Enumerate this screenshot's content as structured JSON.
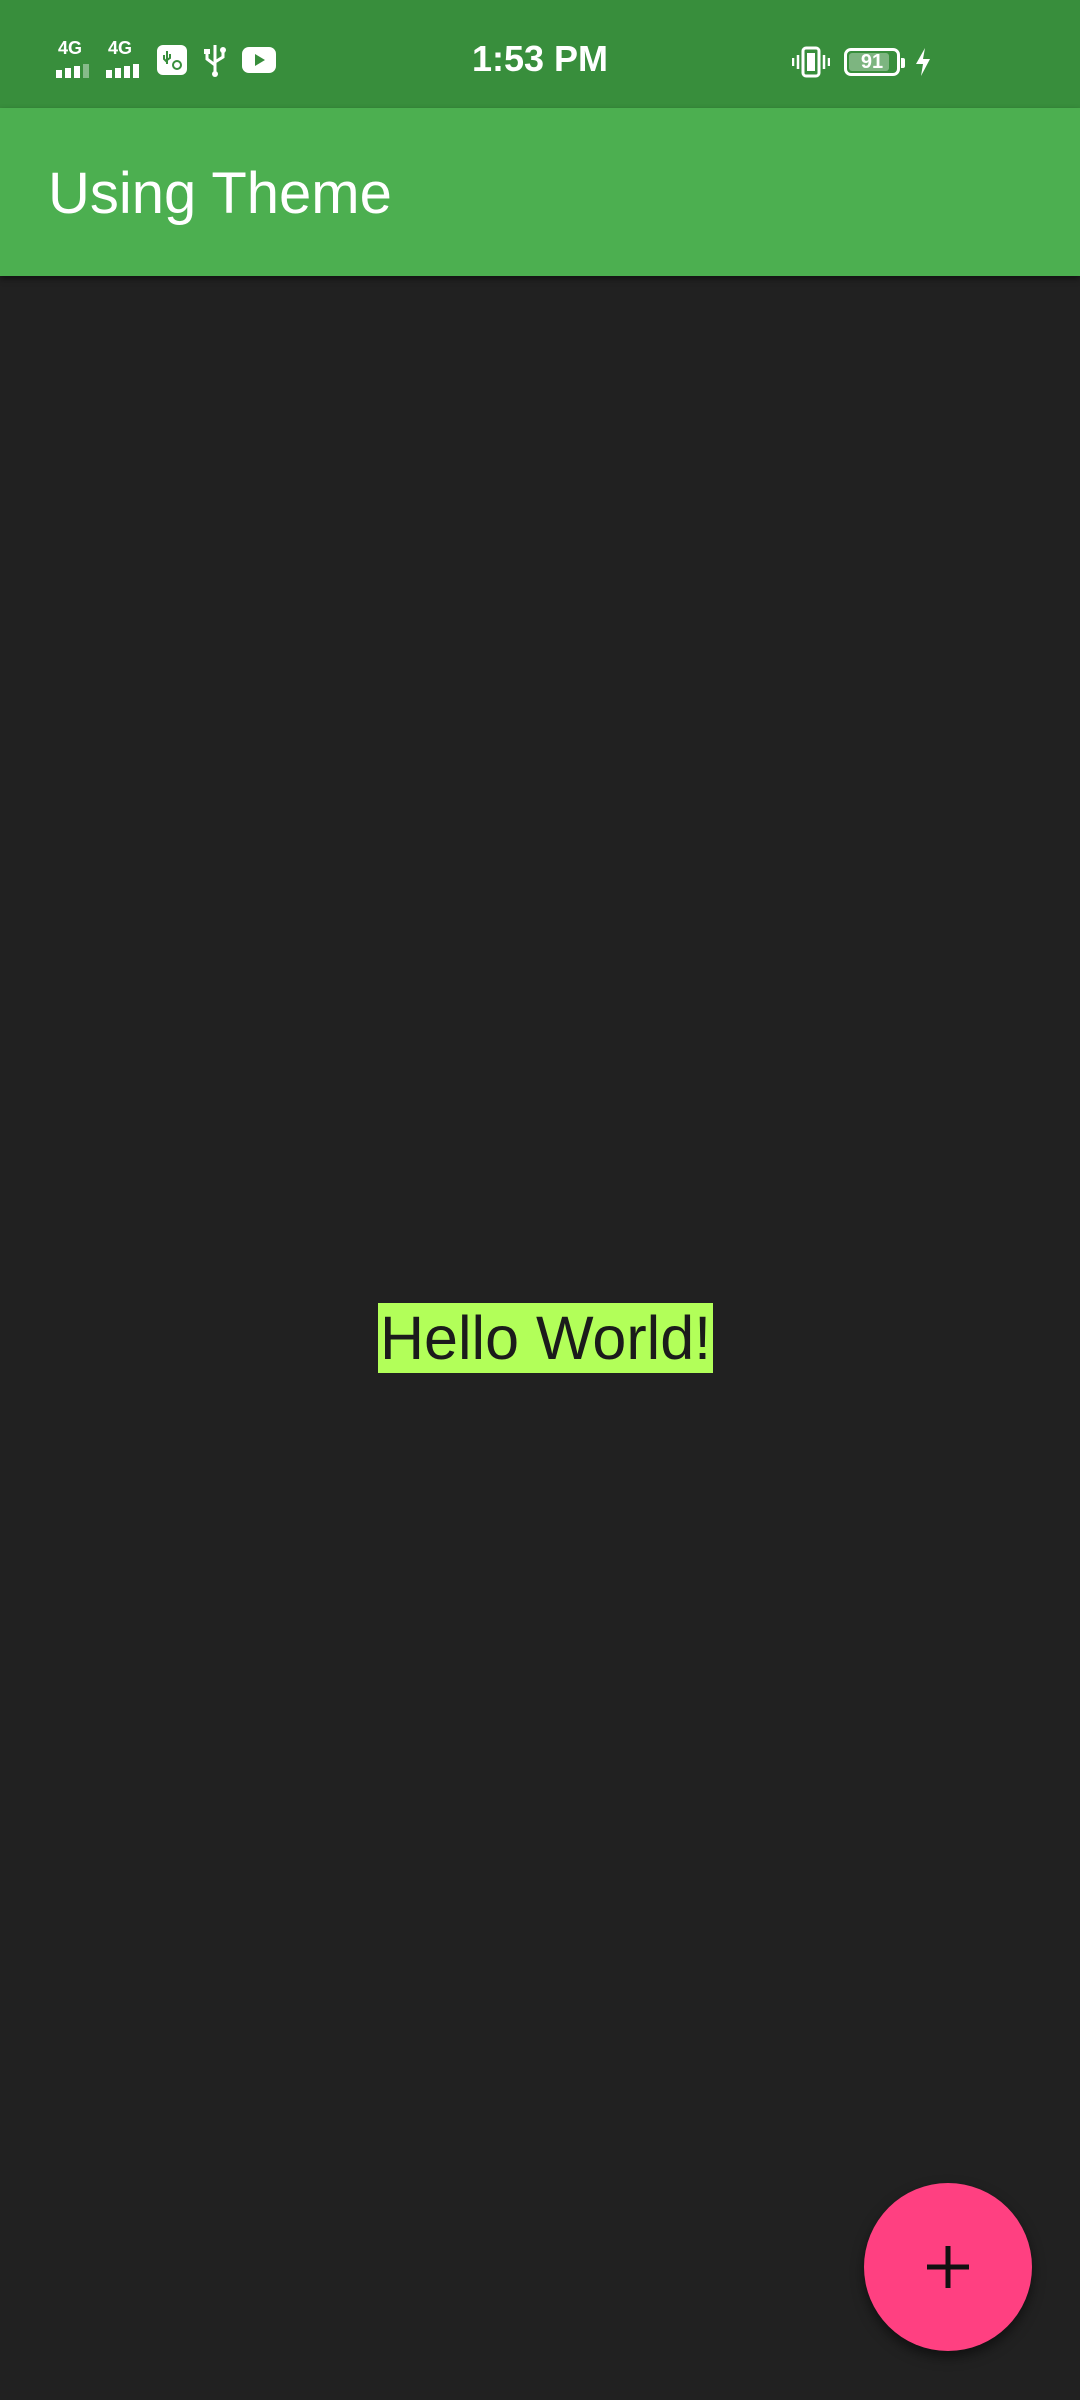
{
  "status_bar": {
    "network_1_label": "4G",
    "network_2_label": "4G",
    "time": "1:53 PM",
    "battery_level": "91",
    "icons": [
      "signal-4g-icon",
      "signal-4g-icon",
      "usb-settings-icon",
      "usb-icon",
      "youtube-icon",
      "vibrate-icon",
      "battery-icon",
      "charging-icon"
    ]
  },
  "app_bar": {
    "title": "Using Theme"
  },
  "main": {
    "message": "Hello World!"
  },
  "fab": {
    "icon": "plus-icon"
  },
  "colors": {
    "status_bar": "#388e3c",
    "app_bar": "#4caf50",
    "background": "#212121",
    "highlight": "#b2ff59",
    "fab": "#ff4081"
  }
}
